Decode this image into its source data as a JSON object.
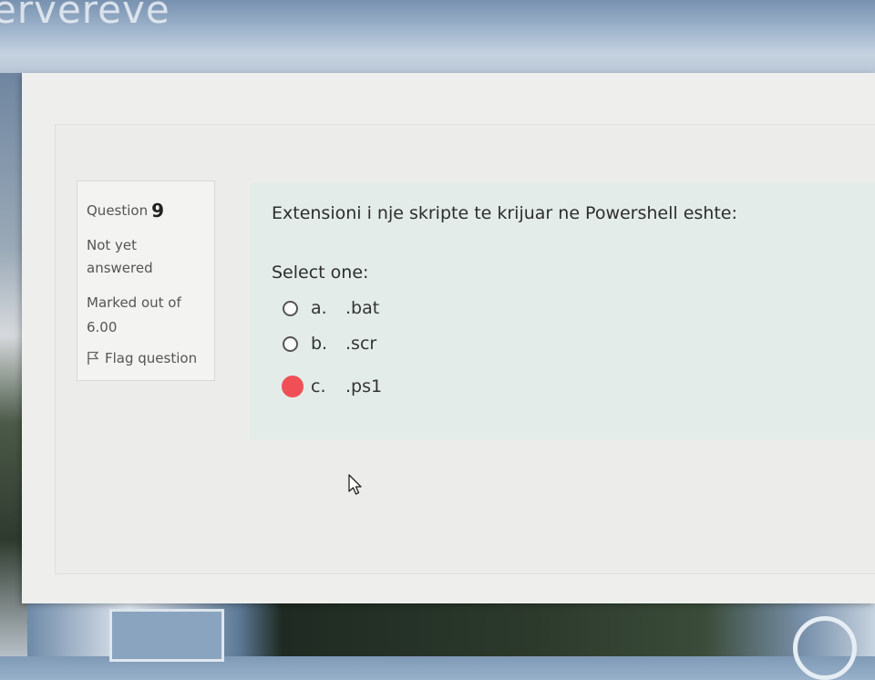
{
  "background": {
    "title_fragment": "ervereve"
  },
  "info": {
    "question_label": "Question",
    "question_number": "9",
    "state": "Not yet answered",
    "grade": "Marked out of 6.00",
    "flag_label": "Flag question",
    "flag_icon": "flag-icon"
  },
  "question": {
    "text": "Extensioni i nje skripte te krijuar ne Powershell eshte:",
    "prompt": "Select one:",
    "options": [
      {
        "letter": "a.",
        "text": ".bat",
        "selected": false
      },
      {
        "letter": "b.",
        "text": ".scr",
        "selected": false
      },
      {
        "letter": "c.",
        "text": ".ps1",
        "selected": true
      }
    ]
  },
  "colors": {
    "selected_radio": "#f04f55",
    "content_background": "#e3ece9"
  }
}
